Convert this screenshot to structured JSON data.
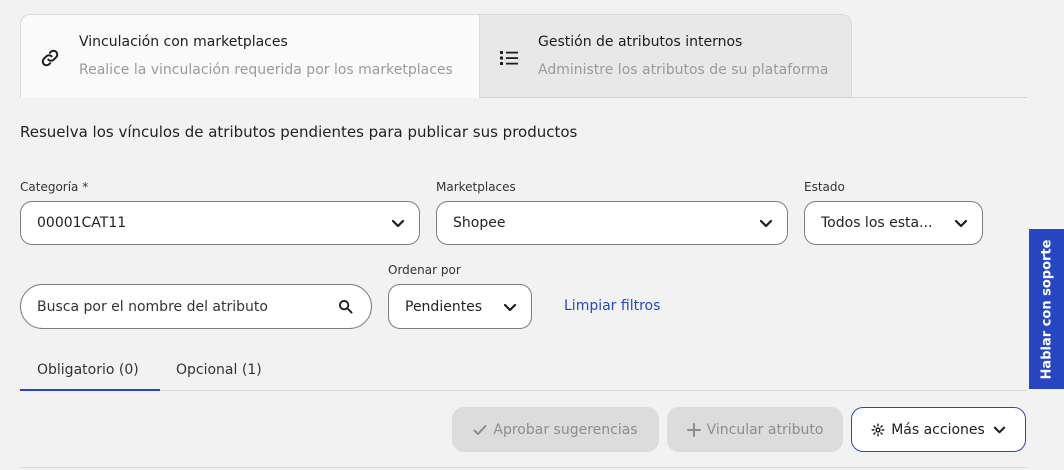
{
  "tabs": [
    {
      "title": "Vinculación con marketplaces",
      "subtitle": "Realice la vinculación requerida por los marketplaces",
      "icon": "link-icon"
    },
    {
      "title": "Gestión de atributos internos",
      "subtitle": "Administre los atributos de su plataforma",
      "icon": "list-icon"
    }
  ],
  "intro": "Resuelva los vínculos de atributos pendientes para publicar sus productos",
  "filters": {
    "category": {
      "label": "Categoría *",
      "value": "00001CAT11"
    },
    "marketplaces": {
      "label": "Marketplaces",
      "value": "Shopee"
    },
    "status": {
      "label": "Estado",
      "value": "Todos los esta..."
    },
    "search": {
      "placeholder": "Busca por el nombre del atributo"
    },
    "sort": {
      "label": "Ordenar por",
      "value": "Pendientes"
    },
    "clear": "Limpiar filtros"
  },
  "subtabs": [
    "Obligatorio (0)",
    "Opcional (1)"
  ],
  "actions": {
    "approve": "Aprobar sugerencias",
    "link": "Vincular atributo",
    "more": "Más acciones"
  },
  "support": "Hablar con soporte",
  "colors": {
    "accent": "#2746c2",
    "background": "#f2f2f2"
  }
}
